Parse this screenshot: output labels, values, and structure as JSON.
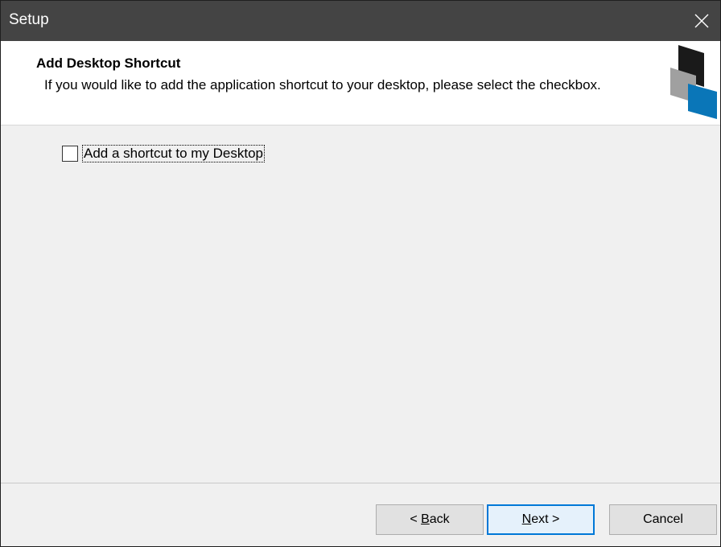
{
  "window": {
    "title": "Setup"
  },
  "header": {
    "title": "Add Desktop Shortcut",
    "description": "If you would like to add the application shortcut to your desktop, please select the checkbox."
  },
  "options": {
    "shortcut_checkbox": {
      "label": "Add a shortcut to my Desktop",
      "checked": false
    }
  },
  "buttons": {
    "back": {
      "prefix": "< ",
      "accel": "B",
      "rest": "ack"
    },
    "next": {
      "accel": "N",
      "rest": "ext >"
    },
    "cancel": {
      "label": "Cancel"
    }
  },
  "icons": {
    "close": "close-icon",
    "logo": "setup-logo-icon"
  },
  "colors": {
    "titlebar": "#444444",
    "accent": "#0078d7",
    "logo_dark": "#1a1a1a",
    "logo_gray": "#a0a0a0",
    "logo_blue": "#0a76b8"
  }
}
